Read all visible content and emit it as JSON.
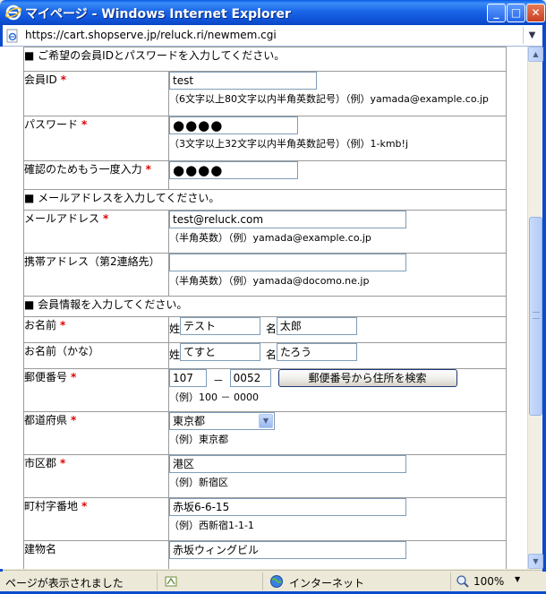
{
  "window": {
    "title": "マイページ - Windows Internet Explorer",
    "url": "https://cart.shopserve.jp/reluck.ri/newmem.cgi",
    "buttons": {
      "minimize": "_",
      "maximize": "□",
      "close": "✕"
    }
  },
  "colors": {
    "required": "#e00000",
    "titlebar": "#0a5ae8"
  },
  "form": {
    "sections": {
      "account": "■ ご希望の会員IDとパスワードを入力してください。",
      "mail": "■ メールアドレスを入力してください。",
      "member": "■ 会員情報を入力してください。"
    },
    "required_mark": "*",
    "fields": {
      "member_id": {
        "label": "会員ID",
        "value": "test",
        "hint": "（6文字以上80文字以内半角英数記号）（例）yamada@example.co.jp"
      },
      "password": {
        "label": "パスワード",
        "value": "●●●●",
        "hint": "（3文字以上32文字以内半角英数記号）（例）1-kmb!j"
      },
      "password_confirm": {
        "label": "確認のためもう一度入力",
        "value": "●●●●"
      },
      "email": {
        "label": "メールアドレス",
        "value": "test@reluck.com",
        "hint": "（半角英数）（例）yamada@example.co.jp"
      },
      "mobile_email": {
        "label": "携帯アドレス（第2連絡先）",
        "value": "",
        "hint": "（半角英数）（例）yamada@docomo.ne.jp"
      },
      "name": {
        "label": "お名前",
        "sei_prefix": "姓",
        "sei": "テスト",
        "mei_prefix": "名",
        "mei": "太郎"
      },
      "name_kana": {
        "label": "お名前（かな）",
        "sei_prefix": "姓",
        "sei": "てすと",
        "mei_prefix": "名",
        "mei": "たろう"
      },
      "postal": {
        "label": "郵便番号",
        "part1": "107",
        "sep": "－",
        "part2": "0052",
        "button": "郵便番号から住所を検索",
        "hint": "（例）100 － 0000"
      },
      "prefecture": {
        "label": "都道府県",
        "selected": "東京都",
        "hint": "（例）東京都"
      },
      "city": {
        "label": "市区郡",
        "value": "港区",
        "hint": "（例）新宿区"
      },
      "street": {
        "label": "町村字番地",
        "value": "赤坂6-6-15",
        "hint": "（例）西新宿1-1-1"
      },
      "building": {
        "label": "建物名",
        "value": "赤坂ウィングビル"
      }
    }
  },
  "statusbar": {
    "text": "ページが表示されました",
    "zone": "インターネット",
    "zoom": "100%"
  }
}
